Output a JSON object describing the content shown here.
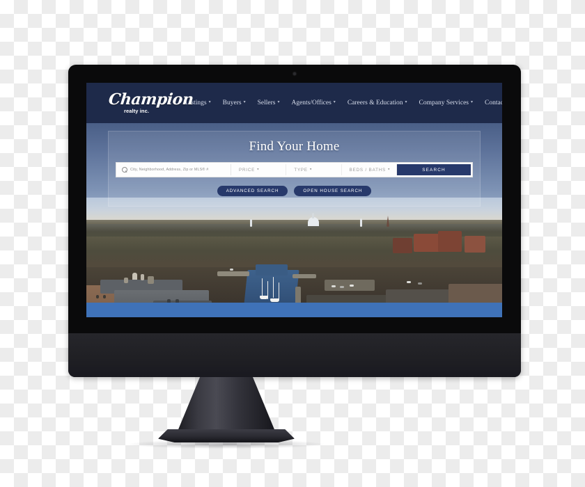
{
  "site": {
    "logo": {
      "brand": "Champion",
      "tagline": "realty inc."
    },
    "nav": [
      {
        "label": "Listings",
        "caret": "▾"
      },
      {
        "label": "Buyers",
        "caret": "▾"
      },
      {
        "label": "Sellers",
        "caret": "▾"
      },
      {
        "label": "Agents/Offices",
        "caret": "▾"
      },
      {
        "label": "Careers & Education",
        "caret": "▾"
      },
      {
        "label": "Company Services",
        "caret": "▾"
      },
      {
        "label": "Contact Us",
        "caret": "▾"
      }
    ],
    "hero": {
      "title": "Find Your Home",
      "search": {
        "icon": "search-icon",
        "placeholder": "City, Neighborhood, Address, Zip or MLS® #",
        "value": "",
        "filters": [
          {
            "label": "PRICE",
            "caret": "▾"
          },
          {
            "label": "TYPE",
            "caret": "▾"
          },
          {
            "label": "BEDS / BATHS",
            "caret": "▾"
          }
        ],
        "submit_label": "SEARCH"
      },
      "actions": [
        {
          "label": "ADVANCED SEARCH"
        },
        {
          "label": "OPEN HOUSE SEARCH"
        }
      ],
      "photo_description": "Aerial view of Annapolis waterfront with harbor, sailboats and State House dome"
    }
  },
  "device": {
    "type": "desktop-monitor",
    "webcam": "webcam-dot"
  },
  "colors": {
    "header_navy": "#1e2a4a",
    "accent_navy": "#27396b",
    "bottom_bar_blue": "#3f72b8",
    "bezel_black": "#0a0a0b",
    "chin_gray": "#232328"
  }
}
